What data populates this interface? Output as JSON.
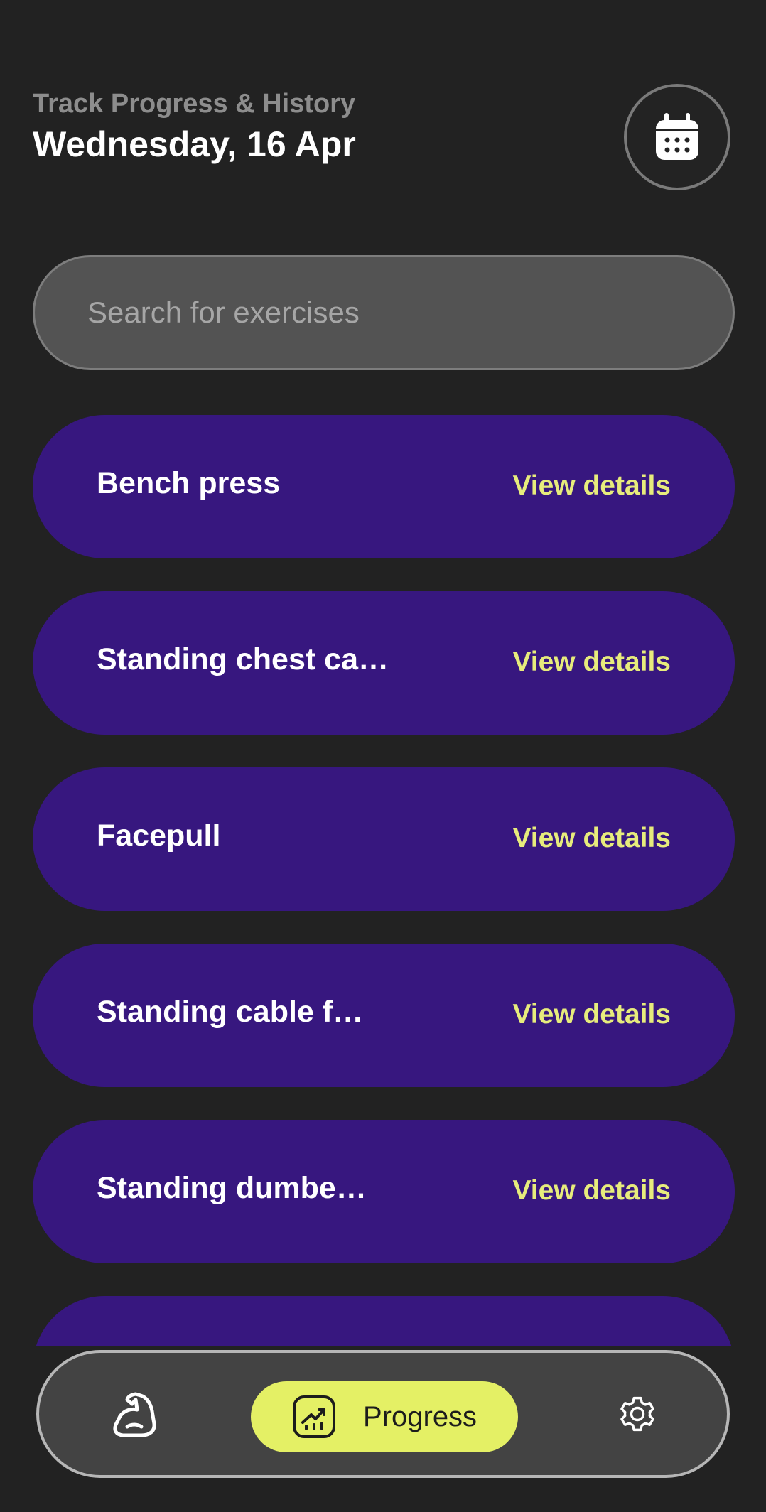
{
  "header": {
    "subtitle": "Track Progress & History",
    "title": "Wednesday, 16 Apr"
  },
  "search": {
    "placeholder": "Search for exercises",
    "value": ""
  },
  "exercises": [
    {
      "name": "Bench press",
      "details_label": "View details"
    },
    {
      "name": "Standing chest cab…",
      "details_label": "View details"
    },
    {
      "name": "Facepull",
      "details_label": "View details"
    },
    {
      "name": "Standing cable f…",
      "details_label": "View details"
    },
    {
      "name": "Standing dumbe…",
      "details_label": "View details"
    },
    {
      "name": "",
      "details_label": ""
    }
  ],
  "nav": {
    "workout_icon": "flexed-bicep-icon",
    "progress_label": "Progress",
    "progress_icon": "chart-trend-icon",
    "settings_icon": "gear-icon"
  },
  "colors": {
    "background": "#222222",
    "card": "#37177f",
    "accent": "#e7ec7c",
    "nav_active": "#e4f065"
  }
}
